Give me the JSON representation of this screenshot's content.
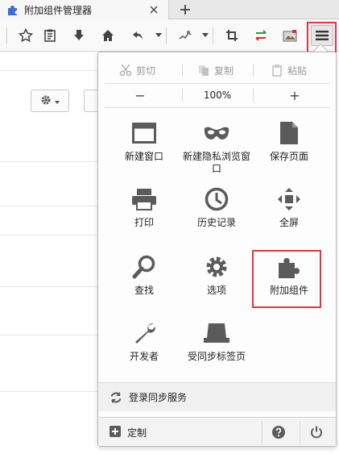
{
  "tab": {
    "title": "附加组件管理器"
  },
  "edit": {
    "cut": "剪切",
    "copy": "复制",
    "paste": "粘贴"
  },
  "zoom": {
    "minus": "−",
    "value": "100%",
    "plus": "+"
  },
  "grid": [
    {
      "label": "新建窗口",
      "icon": "window-icon"
    },
    {
      "label": "新建隐私浏览窗口",
      "icon": "mask-icon"
    },
    {
      "label": "保存页面",
      "icon": "page-icon"
    },
    {
      "label": "打印",
      "icon": "printer-icon"
    },
    {
      "label": "历史记录",
      "icon": "clock-icon"
    },
    {
      "label": "全屏",
      "icon": "fullscreen-icon"
    },
    {
      "label": "查找",
      "icon": "magnifier-icon"
    },
    {
      "label": "选项",
      "icon": "gear-icon"
    },
    {
      "label": "附加组件",
      "icon": "puzzle-icon"
    },
    {
      "label": "开发者",
      "icon": "wrench-icon"
    },
    {
      "label": "受同步标签页",
      "icon": "synced-tabs-icon"
    }
  ],
  "sync": {
    "label": "登录同步服务"
  },
  "footer": {
    "customize": "定制"
  },
  "colors": {
    "highlight": "#e8333a",
    "icon_gray": "#5b5b5b"
  }
}
